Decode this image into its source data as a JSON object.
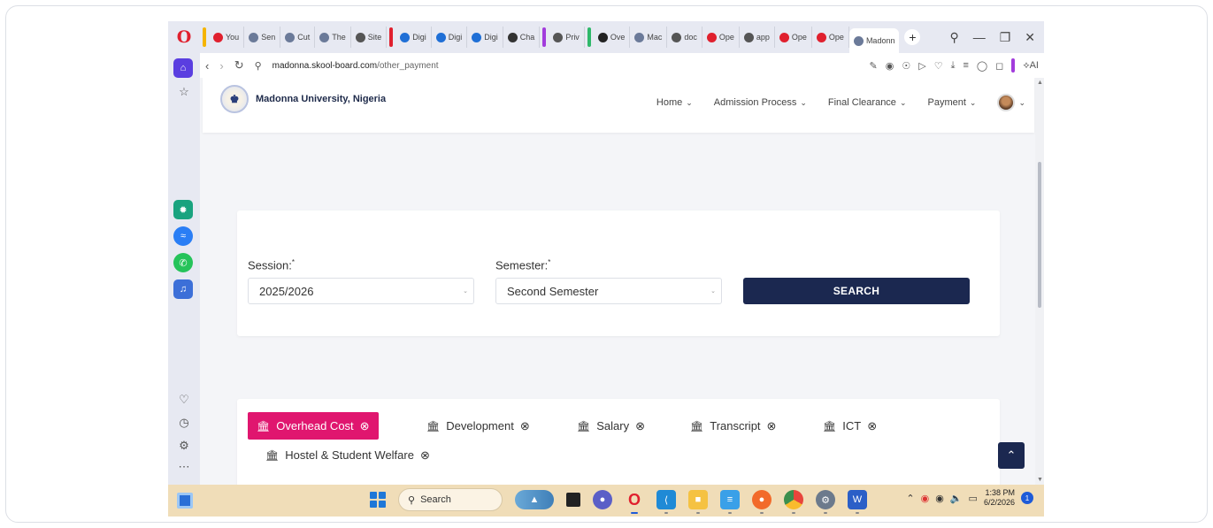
{
  "browser": {
    "tabs": [
      {
        "label": "You",
        "color": "#e0202e",
        "sep": "#f5b400"
      },
      {
        "label": "Sen",
        "color": "#6b7a99",
        "sep": ""
      },
      {
        "label": "Cut",
        "color": "#6b7a99",
        "sep": ""
      },
      {
        "label": "The",
        "color": "#6b7a99",
        "sep": ""
      },
      {
        "label": "Site",
        "color": "#555555",
        "sep": ""
      },
      {
        "label": "Digi",
        "color": "#1f6fd6",
        "sep": "#e0202e"
      },
      {
        "label": "Digi",
        "color": "#1f6fd6",
        "sep": ""
      },
      {
        "label": "Digi",
        "color": "#1f6fd6",
        "sep": ""
      },
      {
        "label": "Cha",
        "color": "#333333",
        "sep": ""
      },
      {
        "label": "Priv",
        "color": "#555555",
        "sep": "#a23cdc"
      },
      {
        "label": "Ove",
        "color": "#222222",
        "sep": "#2fb86a"
      },
      {
        "label": "Mac",
        "color": "#6b7a99",
        "sep": ""
      },
      {
        "label": "doc",
        "color": "#555555",
        "sep": ""
      },
      {
        "label": "Ope",
        "color": "#e0202e",
        "sep": ""
      },
      {
        "label": "app",
        "color": "#555555",
        "sep": ""
      },
      {
        "label": "Ope",
        "color": "#e0202e",
        "sep": ""
      },
      {
        "label": "Ope",
        "color": "#e0202e",
        "sep": ""
      }
    ],
    "active_tab": "Madonn",
    "url_domain": "madonna.skool-board.com",
    "url_path": "/other_payment",
    "ai_label": "AI"
  },
  "site": {
    "brand": "Madonna University, Nigeria",
    "nav": [
      {
        "label": "Home"
      },
      {
        "label": "Admission Process"
      },
      {
        "label": "Final Clearance"
      },
      {
        "label": "Payment"
      }
    ]
  },
  "search_form": {
    "session_label": "Session:",
    "session_value": "2025/2026",
    "semester_label": "Semester:",
    "semester_value": "Second Semester",
    "required_mark": "*",
    "search_button": "SEARCH"
  },
  "payment_tabs": [
    {
      "label": "Overhead Cost",
      "active": true
    },
    {
      "label": "Development",
      "active": false
    },
    {
      "label": "Salary",
      "active": false
    },
    {
      "label": "Transcript",
      "active": false
    },
    {
      "label": "ICT",
      "active": false
    },
    {
      "label": "Hostel & Student Welfare",
      "active": false
    }
  ],
  "taskbar": {
    "search_placeholder": "Search",
    "time": "1:38 PM",
    "date": "6/2/2026",
    "notification_count": "1"
  },
  "colors": {
    "accent_pink": "#e0166f",
    "navy": "#1b2850"
  }
}
